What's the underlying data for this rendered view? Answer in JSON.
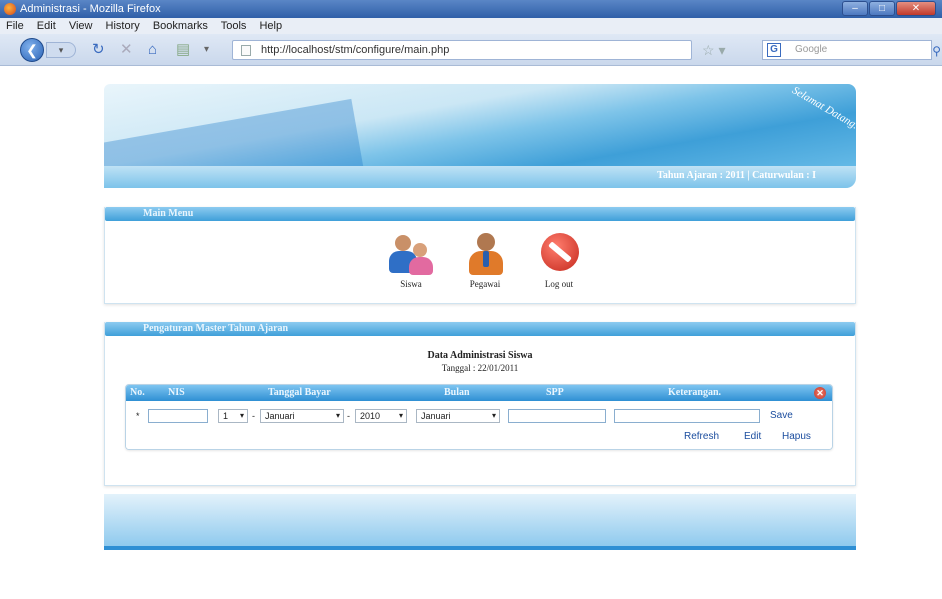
{
  "window": {
    "title": "Administrasi - Mozilla Firefox"
  },
  "menubar": {
    "items": [
      "File",
      "Edit",
      "View",
      "History",
      "Bookmarks",
      "Tools",
      "Help"
    ]
  },
  "nav": {
    "url": "http://localhost/stm/configure/main.php",
    "search_placeholder": "Google"
  },
  "banner": {
    "welcome": "Selamat Datang."
  },
  "yearbar": {
    "text": "Tahun Ajaran : 2011 | Caturwulan : I"
  },
  "main_menu": {
    "title": "Main Menu",
    "items": [
      {
        "label": "Siswa",
        "icon": "students-icon"
      },
      {
        "label": "Pegawai",
        "icon": "employee-icon"
      },
      {
        "label": "Log out",
        "icon": "logout-icon"
      }
    ]
  },
  "settings": {
    "title": "Pengaturan Master Tahun Ajaran",
    "heading": "Data Administrasi Siswa",
    "date": "Tanggal : 22/01/2011"
  },
  "grid": {
    "columns": [
      "No.",
      "NIS",
      "Tanggal Bayar",
      "Bulan",
      "SPP",
      "Keterangan."
    ],
    "row_marker": "*",
    "day": "1",
    "month_select": "Januari",
    "year_select": "2010",
    "bulan_select": "Januari",
    "sep1": "-",
    "sep2": "-",
    "actions": {
      "save": "Save",
      "refresh": "Refresh",
      "edit": "Edit",
      "delete": "Hapus"
    }
  },
  "colors": {
    "accent": "#3f9fd9",
    "header_text": "#eaf6fe",
    "link": "#1a4c9e"
  }
}
